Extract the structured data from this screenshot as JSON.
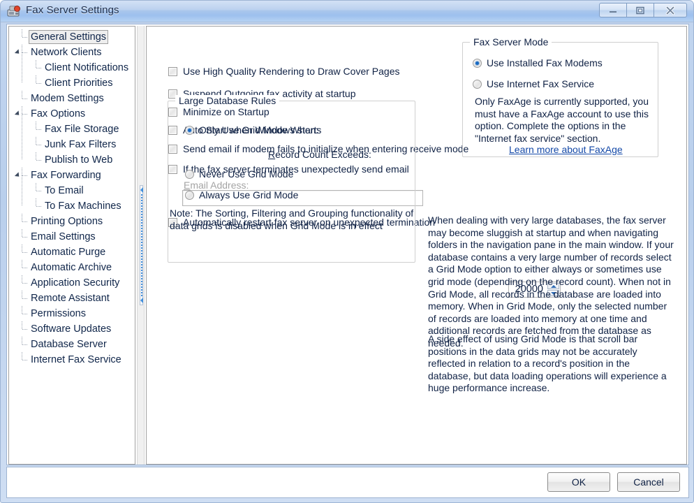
{
  "window": {
    "title": "Fax Server Settings",
    "icon": "fax-machine-icon",
    "minimize_label": "Minimize",
    "maximize_label": "Restore",
    "close_label": "Close"
  },
  "sidebar": {
    "items": [
      {
        "label": "General Settings",
        "level": 0,
        "expander": false,
        "selected": true
      },
      {
        "label": "Network Clients",
        "level": 0,
        "expander": true,
        "selected": false
      },
      {
        "label": "Client Notifications",
        "level": 1,
        "expander": false,
        "selected": false
      },
      {
        "label": "Client Priorities",
        "level": 1,
        "expander": false,
        "selected": false
      },
      {
        "label": "Modem Settings",
        "level": 0,
        "expander": false,
        "selected": false
      },
      {
        "label": "Fax Options",
        "level": 0,
        "expander": true,
        "selected": false
      },
      {
        "label": "Fax File Storage",
        "level": 1,
        "expander": false,
        "selected": false
      },
      {
        "label": "Junk Fax Filters",
        "level": 1,
        "expander": false,
        "selected": false
      },
      {
        "label": "Publish to Web",
        "level": 1,
        "expander": false,
        "selected": false
      },
      {
        "label": "Fax Forwarding",
        "level": 0,
        "expander": true,
        "selected": false
      },
      {
        "label": "To Email",
        "level": 1,
        "expander": false,
        "selected": false
      },
      {
        "label": "To Fax Machines",
        "level": 1,
        "expander": false,
        "selected": false
      },
      {
        "label": "Printing Options",
        "level": 0,
        "expander": false,
        "selected": false
      },
      {
        "label": "Email Settings",
        "level": 0,
        "expander": false,
        "selected": false
      },
      {
        "label": "Automatic Purge",
        "level": 0,
        "expander": false,
        "selected": false
      },
      {
        "label": "Automatic Archive",
        "level": 0,
        "expander": false,
        "selected": false
      },
      {
        "label": "Application Security",
        "level": 0,
        "expander": false,
        "selected": false
      },
      {
        "label": "Remote Assistant",
        "level": 0,
        "expander": false,
        "selected": false
      },
      {
        "label": "Permissions",
        "level": 0,
        "expander": false,
        "selected": false
      },
      {
        "label": "Software Updates",
        "level": 0,
        "expander": false,
        "selected": false
      },
      {
        "label": "Database Server",
        "level": 0,
        "expander": false,
        "selected": false
      },
      {
        "label": "Internet Fax Service",
        "level": 0,
        "expander": false,
        "selected": false
      }
    ]
  },
  "general": {
    "checkboxes": [
      {
        "label": "Use High Quality Rendering to Draw Cover Pages",
        "checked": false
      },
      {
        "label": "Suspend Outgoing fax activity at startup",
        "checked": false
      },
      {
        "label": "Minimize on Startup",
        "checked": false
      },
      {
        "label": "Auto Start when Windows starts",
        "checked": false
      },
      {
        "label": "Send email if modem fails to initialize when entering receive mode",
        "checked": false
      },
      {
        "label": "If the fax server terminates unexpectedly send email",
        "checked": false
      }
    ],
    "email_address_label_mnemonic": "E",
    "email_address_label_rest": "mail Address:",
    "email_address_value": "",
    "auto_restart": {
      "label": "Automatically restart fax server on unexpected termination",
      "checked": false
    }
  },
  "large_database_rules": {
    "title": "Large Database Rules",
    "options": [
      {
        "label": "Only Use Grid Mode When:",
        "selected": true
      },
      {
        "label": "Never Use Grid Mode",
        "selected": false
      },
      {
        "label": "Always Use Grid Mode",
        "selected": false
      }
    ],
    "record_count_label_mnemonic": "R",
    "record_count_label_rest": "ecord Count Exceeds:",
    "record_count_value": "20000",
    "note": "Note: The Sorting, Filtering and Grouping functionality of data grids is disabled when Grid Mode is in effect"
  },
  "fax_server_mode": {
    "title": "Fax Server Mode",
    "options": [
      {
        "label": "Use Installed Fax Modems",
        "selected": true
      },
      {
        "label": "Use Internet Fax Service",
        "selected": false
      }
    ],
    "description": "Only FaxAge is currently supported, you must have a FaxAge account to use this option.  Complete the options in the \"Internet fax service\" section.",
    "link": "Learn more about FaxAge"
  },
  "help_text": {
    "paragraph1": "When dealing with very large databases, the fax server may become sluggish at startup and when navigating folders in the navigation pane in the main window.  If your database contains a very large number of records select a Grid Mode option to either always or sometimes use grid mode (depending on the record count).  When not in Grid Mode, all records in the database are loaded into memory. When in Grid Mode, only the selected number of records are loaded into memory at one time and additional records are fetched from the database as needed.",
    "paragraph2": "A side effect of using Grid Mode is that scroll bar positions in the data grids may not be accurately reflected in relation to a record's position in the database, but data loading operations will experience a huge performance increase."
  },
  "footer": {
    "ok_label": "OK",
    "cancel_label": "Cancel"
  },
  "colors": {
    "title_bar": "#a9c6ec",
    "accent_link": "#1449a8",
    "radio_dot": "#1769c2",
    "splitter_dots": "#3f8ddb"
  }
}
